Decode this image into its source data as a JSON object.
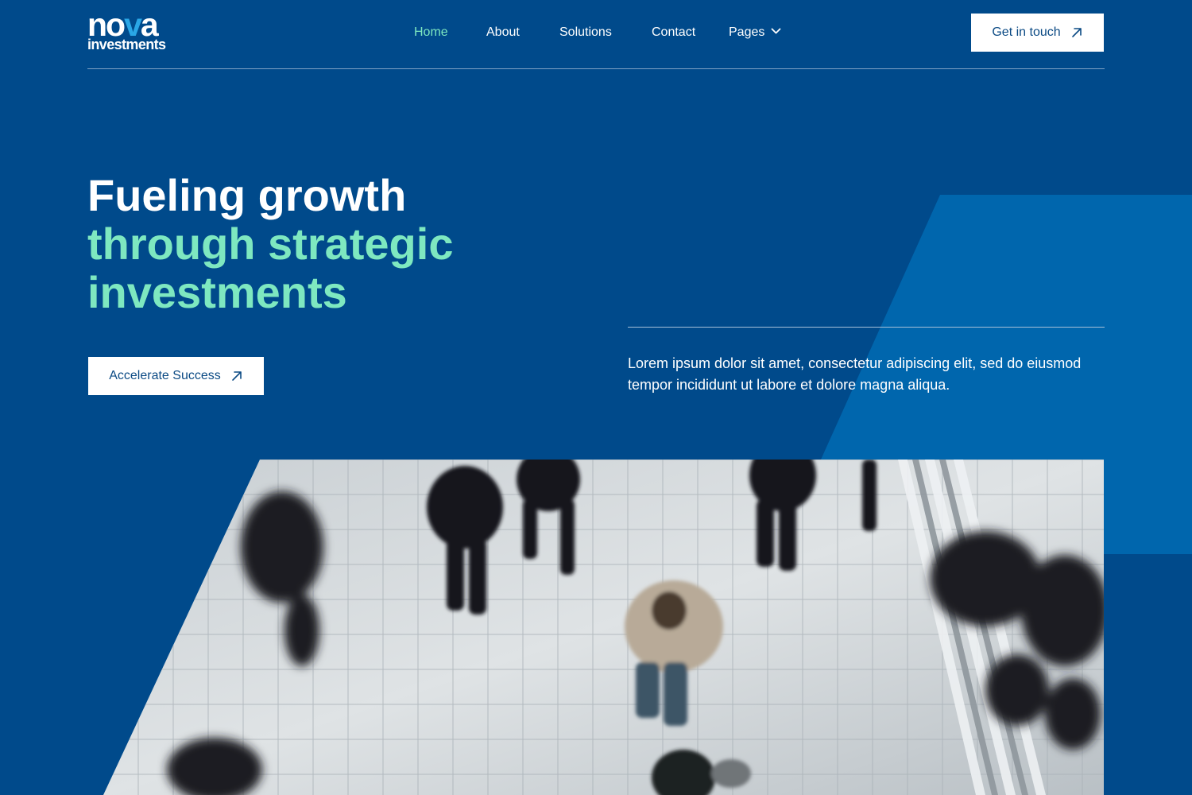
{
  "brand": {
    "logo_word_start": "no",
    "logo_word_v": "v",
    "logo_word_end": "a",
    "logo_sub": "investments"
  },
  "nav": {
    "items": [
      {
        "label": "Home",
        "active": true
      },
      {
        "label": "About",
        "active": false
      },
      {
        "label": "Solutions",
        "active": false
      },
      {
        "label": "Contact",
        "active": false
      },
      {
        "label": "Pages",
        "active": false,
        "has_dropdown": true
      }
    ],
    "cta_label": "Get in touch"
  },
  "hero": {
    "title_line1": "Fueling growth",
    "title_line2": "through strategic",
    "title_line3": "investments",
    "cta_label": "Accelerate Success",
    "description": "Lorem ipsum dolor sit amet, consectetur adipiscing elit, sed do eiusmod tempor incididunt ut labore et dolore magna aliqua."
  },
  "icons": {
    "arrow": "arrow-up-right-icon",
    "dropdown": "chevron-down-icon"
  },
  "colors": {
    "background": "#004a8b",
    "accent_shape": "#0066ad",
    "highlight": "#7ee8c0",
    "active_nav": "#7ee8c0",
    "button_bg": "#ffffff",
    "button_text": "#0b4a84"
  }
}
